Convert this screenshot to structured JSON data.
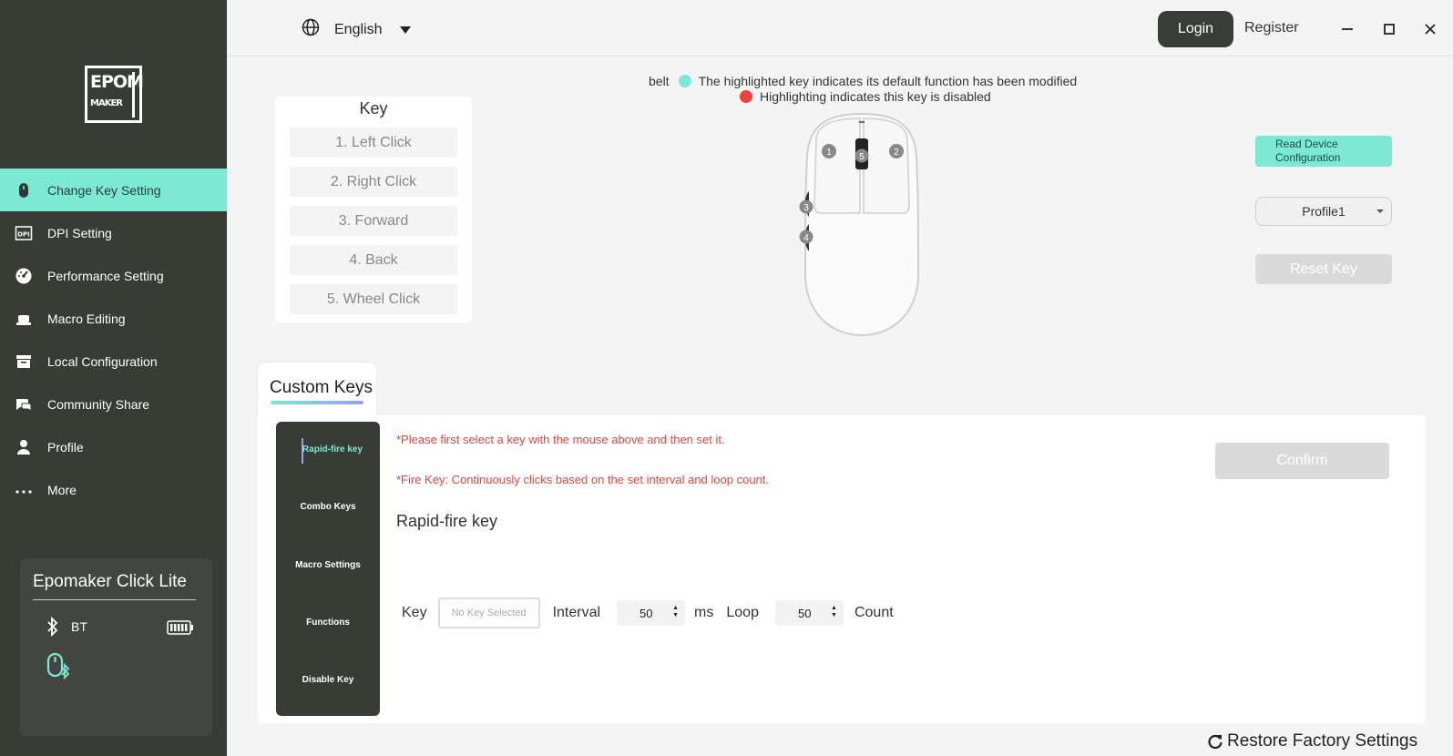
{
  "app": {
    "logo_text_top": "EPOM",
    "logo_text_bottom": "MAKER"
  },
  "sidebar": {
    "items": [
      {
        "label": "Change Key Setting",
        "icon": "mouse-icon",
        "active": true
      },
      {
        "label": "DPI Setting",
        "icon": "dpi-icon",
        "active": false
      },
      {
        "label": "Performance Setting",
        "icon": "speedometer-icon",
        "active": false
      },
      {
        "label": "Macro Editing",
        "icon": "macro-icon",
        "active": false
      },
      {
        "label": "Local Configuration",
        "icon": "archive-icon",
        "active": false
      },
      {
        "label": "Community Share",
        "icon": "chat-icon",
        "active": false
      },
      {
        "label": "Profile",
        "icon": "user-icon",
        "active": false
      },
      {
        "label": "More",
        "icon": "more-icon",
        "active": false
      }
    ]
  },
  "device": {
    "name": "Epomaker Click Lite",
    "connection": "BT"
  },
  "topbar": {
    "language": "English",
    "login": "Login",
    "register": "Register"
  },
  "legend": {
    "prefix": "belt",
    "modified": "The highlighted key indicates its default function has been modified",
    "disabled": "Highlighting indicates this key is disabled",
    "modified_color": "#7ce9d3",
    "disabled_color": "#f2403a"
  },
  "keypanel": {
    "title": "Key",
    "keys": [
      "1. Left Click",
      "2. Right Click",
      "3. Forward",
      "4. Back",
      "5. Wheel Click"
    ]
  },
  "mouse_diagram": {
    "labels": [
      "1",
      "2",
      "3",
      "4",
      "5"
    ]
  },
  "controls": {
    "read_config_line1": "Read Device",
    "read_config_line2": "Configuration",
    "profile": "Profile1",
    "reset_key": "Reset Key"
  },
  "tab": {
    "label": "Custom Keys"
  },
  "subnav": {
    "items": [
      "Rapid-fire key",
      "Combo Keys",
      "Macro Settings",
      "Functions",
      "Disable Key"
    ]
  },
  "content": {
    "note1": "*Please first select a key with the mouse above and then set it.",
    "note2": "*Fire Key: Continuously clicks based on the set interval and loop count.",
    "title": "Rapid-fire key",
    "confirm": "Confirm",
    "key_label": "Key",
    "key_placeholder": "No Key Selected",
    "interval_label": "Interval",
    "interval_value": "50",
    "interval_unit": "ms",
    "loop_label": "Loop",
    "loop_value": "50",
    "loop_unit": "Count"
  },
  "footer": {
    "restore": "Restore Factory Settings"
  }
}
